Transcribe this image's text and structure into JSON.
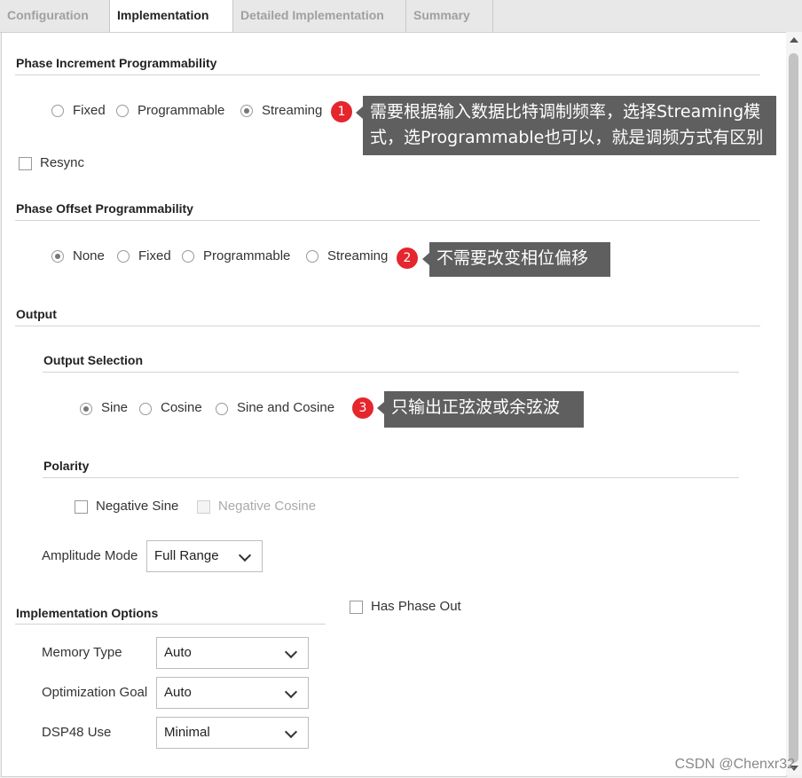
{
  "tabs": [
    "Configuration",
    "Implementation",
    "Detailed Implementation",
    "Summary"
  ],
  "phase_increment": {
    "title": "Phase Increment Programmability",
    "options": [
      "Fixed",
      "Programmable",
      "Streaming"
    ],
    "selected": "Streaming",
    "resync_label": "Resync"
  },
  "phase_offset": {
    "title": "Phase Offset Programmability",
    "options": [
      "None",
      "Fixed",
      "Programmable",
      "Streaming"
    ],
    "selected": "None"
  },
  "output": {
    "title": "Output",
    "selection_title": "Output Selection",
    "options": [
      "Sine",
      "Cosine",
      "Sine and Cosine"
    ],
    "selected": "Sine",
    "polarity_title": "Polarity",
    "negative_sine_label": "Negative Sine",
    "negative_cosine_label": "Negative Cosine",
    "amplitude_label": "Amplitude Mode",
    "amplitude_value": "Full Range"
  },
  "implementation_options": {
    "title": "Implementation Options",
    "has_phase_out_label": "Has Phase Out",
    "memory_type_label": "Memory Type",
    "memory_type_value": "Auto",
    "optimization_goal_label": "Optimization Goal",
    "optimization_goal_value": "Auto",
    "dsp48_label": "DSP48 Use",
    "dsp48_value": "Minimal"
  },
  "annotations": {
    "badge1": "1",
    "callout1": "需要根据输入数据比特调制频率，选择Streaming模式，选Programmable也可以，就是调频方式有区别",
    "badge2": "2",
    "callout2": "不需要改变相位偏移",
    "badge3": "3",
    "callout3": "只输出正弦波或余弦波"
  },
  "watermark": "CSDN @Chenxr32",
  "colors": {
    "badge": "#e5262d",
    "callout_bg": "#5f5f5f"
  }
}
